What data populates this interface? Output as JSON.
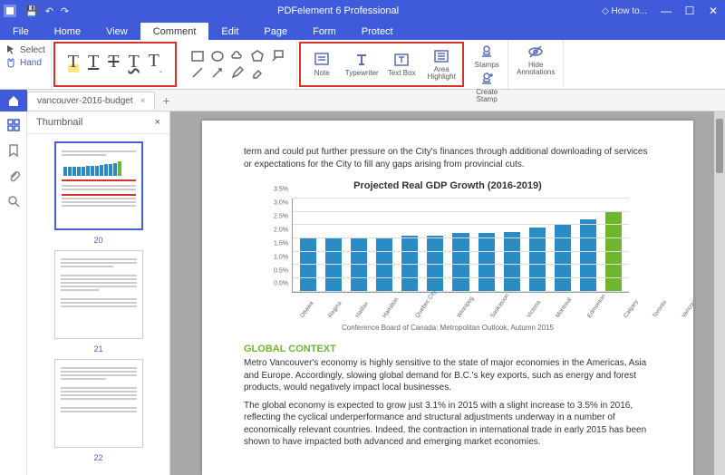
{
  "app": {
    "title": "PDFelement 6 Professional",
    "howto": "How to..."
  },
  "menus": [
    "File",
    "Home",
    "View",
    "Comment",
    "Edit",
    "Page",
    "Form",
    "Protect"
  ],
  "active_menu": "Comment",
  "selection": {
    "select": "Select",
    "hand": "Hand"
  },
  "annot_buttons": [
    {
      "name": "note",
      "label": "Note"
    },
    {
      "name": "typewriter",
      "label": "Typewriter"
    },
    {
      "name": "textbox",
      "label": "Text Box"
    },
    {
      "name": "areahighlight",
      "label": "Area\nHighlight"
    }
  ],
  "right_buttons": [
    {
      "name": "stamps",
      "label": "Stamps"
    },
    {
      "name": "createstamp",
      "label": "Create\nStamp"
    },
    {
      "name": "hideannot",
      "label": "Hide\nAnnotations"
    }
  ],
  "doc_tab": "vancouver-2016-budget",
  "thumb_title": "Thumbnail",
  "thumbs": [
    {
      "n": "20"
    },
    {
      "n": "21"
    },
    {
      "n": "22"
    }
  ],
  "page": {
    "intro": "term and could put further pressure on the City's finances through additional downloading of services or expectations for the City to fill any gaps arising from provincial cuts.",
    "chart_title": "Projected Real GDP Growth (2016-2019)",
    "caption": "Conference Board of Canada: Metropolitan Outlook, Autumn 2015",
    "section": "GLOBAL CONTEXT",
    "p1": "Metro Vancouver's economy is highly sensitive to the state of major economies in the Americas, Asia and Europe. Accordingly, slowing global demand for B.C.'s key exports, such as energy and forest products, would negatively impact local businesses.",
    "p2": "The global economy is expected to grow just 3.1% in 2015 with a slight increase to 3.5% in 2016, reflecting the cyclical underperformance and structural adjustments underway in a number of economically relevant countries. Indeed, the contraction in international trade in early 2015 has been shown to have impacted both advanced and emerging market economies."
  },
  "chart_data": {
    "type": "bar",
    "title": "Projected Real GDP Growth (2016-2019)",
    "xlabel": "",
    "ylabel": "",
    "ylim": [
      0,
      3.5
    ],
    "yticks": [
      0,
      0.5,
      1.0,
      1.5,
      2.0,
      2.5,
      3.0,
      3.5
    ],
    "categories": [
      "Ottawa",
      "Regina",
      "Halifax",
      "Hamilton",
      "Quebec City",
      "Winnipeg",
      "Saskatoon",
      "Victoria",
      "Montreal",
      "Edmonton",
      "Calgary",
      "Toronto",
      "Vancouver"
    ],
    "values": [
      2.0,
      2.0,
      2.0,
      2.0,
      2.1,
      2.1,
      2.2,
      2.2,
      2.25,
      2.4,
      2.55,
      2.7,
      3.0
    ],
    "highlight_index": 12
  }
}
